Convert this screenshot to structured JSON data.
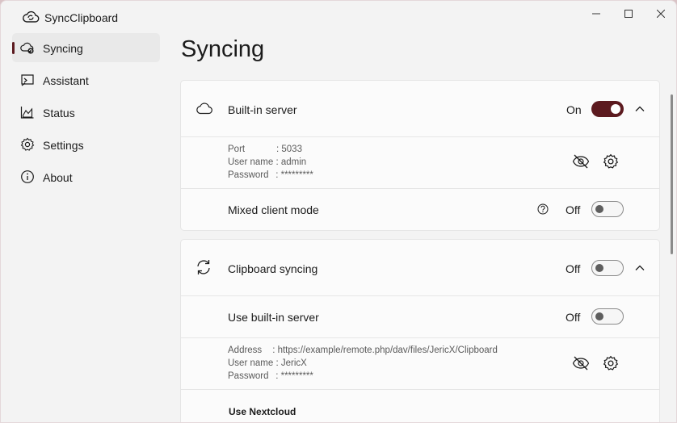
{
  "window": {
    "title": "SyncClipboard"
  },
  "sidebar": {
    "items": [
      {
        "label": "Syncing",
        "icon": "cloud-sync-icon",
        "active": true
      },
      {
        "label": "Assistant",
        "icon": "assistant-icon",
        "active": false
      },
      {
        "label": "Status",
        "icon": "status-chart-icon",
        "active": false
      },
      {
        "label": "Settings",
        "icon": "gear-icon",
        "active": false
      },
      {
        "label": "About",
        "icon": "info-icon",
        "active": false
      }
    ]
  },
  "page": {
    "title": "Syncing"
  },
  "server_card": {
    "header": {
      "label": "Built-in server",
      "state": "On",
      "icon": "cloud-icon",
      "expanded": true
    },
    "info": {
      "port_key": "Port",
      "port_sep": ": ",
      "port_value": "5033",
      "user_key": "User name",
      "user_sep": " : ",
      "user_value": "admin",
      "password_key": "Password",
      "password_sep": " : ",
      "password_value": "*********"
    },
    "mixed_mode": {
      "label": "Mixed client mode",
      "state": "Off",
      "help_icon": "help-circle-icon"
    }
  },
  "clipboard_card": {
    "header": {
      "label": "Clipboard syncing",
      "state": "Off",
      "icon": "refresh-icon",
      "expanded": true
    },
    "use_builtin": {
      "label": "Use built-in server",
      "state": "Off"
    },
    "info": {
      "address_key": "Address",
      "address_sep": " : ",
      "address_value": "https://example/remote.php/dav/files/JericX/Clipboard",
      "user_key": "User name",
      "user_sep": " : ",
      "user_value": "JericX",
      "password_key": "Password",
      "password_sep": " : ",
      "password_value": "*********"
    },
    "nextcloud": {
      "label": "Use Nextcloud"
    }
  },
  "colors": {
    "accent": "#5c1a1f",
    "background": "#f3f3f3",
    "card": "#fbfbfb"
  }
}
